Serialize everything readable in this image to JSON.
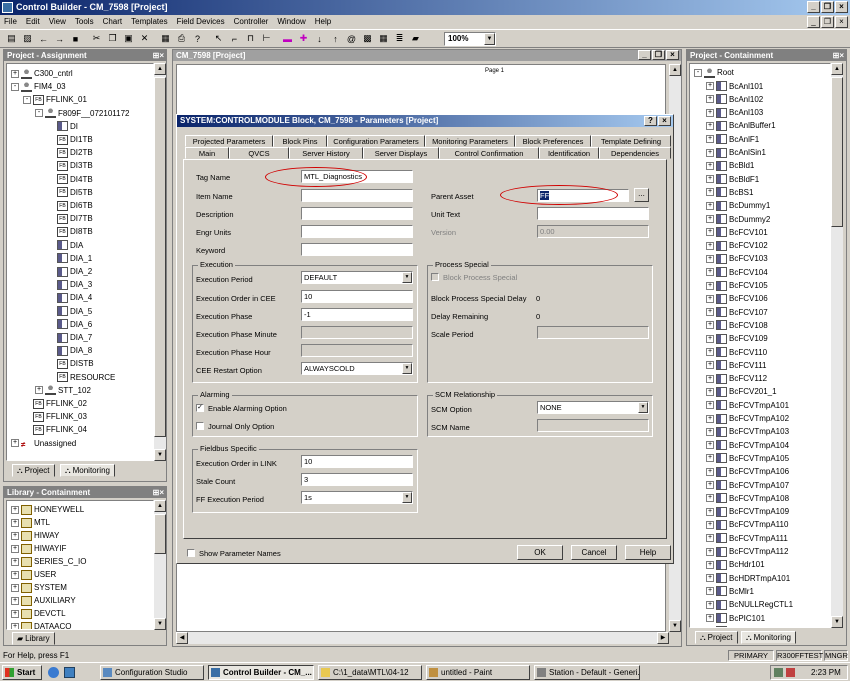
{
  "app": {
    "title": "Control Builder - CM_7598 [Project]"
  },
  "menu": [
    "File",
    "Edit",
    "View",
    "Tools",
    "Chart",
    "Templates",
    "Field Devices",
    "Controller",
    "Window",
    "Help"
  ],
  "toolbar": {
    "zoom": "100%"
  },
  "assignment": {
    "title": "Project - Assignment",
    "items": [
      {
        "label": "C300_cntrl",
        "depth": 1,
        "pm": "+",
        "icon": "node"
      },
      {
        "label": "FIM4_03",
        "depth": 1,
        "pm": "-",
        "icon": "node"
      },
      {
        "label": "FFLINK_01",
        "depth": 2,
        "pm": "-",
        "icon": "fb"
      },
      {
        "label": "F809F__072101172",
        "depth": 3,
        "pm": "-",
        "icon": "node"
      },
      {
        "label": "DI",
        "depth": 4,
        "pm": "",
        "icon": "blk"
      },
      {
        "label": "DI1TB",
        "depth": 4,
        "pm": "",
        "icon": "fb"
      },
      {
        "label": "DI2TB",
        "depth": 4,
        "pm": "",
        "icon": "fb"
      },
      {
        "label": "DI3TB",
        "depth": 4,
        "pm": "",
        "icon": "fb"
      },
      {
        "label": "DI4TB",
        "depth": 4,
        "pm": "",
        "icon": "fb"
      },
      {
        "label": "DI5TB",
        "depth": 4,
        "pm": "",
        "icon": "fb"
      },
      {
        "label": "DI6TB",
        "depth": 4,
        "pm": "",
        "icon": "fb"
      },
      {
        "label": "DI7TB",
        "depth": 4,
        "pm": "",
        "icon": "fb"
      },
      {
        "label": "DI8TB",
        "depth": 4,
        "pm": "",
        "icon": "fb"
      },
      {
        "label": "DIA",
        "depth": 4,
        "pm": "",
        "icon": "blk"
      },
      {
        "label": "DIA_1",
        "depth": 4,
        "pm": "",
        "icon": "blk"
      },
      {
        "label": "DIA_2",
        "depth": 4,
        "pm": "",
        "icon": "blk"
      },
      {
        "label": "DIA_3",
        "depth": 4,
        "pm": "",
        "icon": "blk"
      },
      {
        "label": "DIA_4",
        "depth": 4,
        "pm": "",
        "icon": "blk"
      },
      {
        "label": "DIA_5",
        "depth": 4,
        "pm": "",
        "icon": "blk"
      },
      {
        "label": "DIA_6",
        "depth": 4,
        "pm": "",
        "icon": "blk"
      },
      {
        "label": "DIA_7",
        "depth": 4,
        "pm": "",
        "icon": "blk"
      },
      {
        "label": "DIA_8",
        "depth": 4,
        "pm": "",
        "icon": "blk"
      },
      {
        "label": "DISTB",
        "depth": 4,
        "pm": "",
        "icon": "fb"
      },
      {
        "label": "RESOURCE",
        "depth": 4,
        "pm": "",
        "icon": "fb"
      },
      {
        "label": "STT_102",
        "depth": 3,
        "pm": "+",
        "icon": "node"
      },
      {
        "label": "FFLINK_02",
        "depth": 2,
        "pm": "",
        "icon": "fb"
      },
      {
        "label": "FFLINK_03",
        "depth": 2,
        "pm": "",
        "icon": "fb"
      },
      {
        "label": "FFLINK_04",
        "depth": 2,
        "pm": "",
        "icon": "fb"
      },
      {
        "label": "Unassigned",
        "depth": 1,
        "pm": "+",
        "icon": "ne"
      }
    ],
    "tabs": [
      "Project",
      "Monitoring"
    ]
  },
  "library": {
    "title": "Library - Containment",
    "items": [
      "HONEYWELL",
      "MTL",
      "HIWAY",
      "HIWAYIF",
      "SERIES_C_IO",
      "USER",
      "SYSTEM",
      "AUXILIARY",
      "DEVCTL",
      "DATAACQ"
    ],
    "tab": "Library"
  },
  "chart": {
    "title": "CM_7598 [Project]",
    "page": "Page 1"
  },
  "containment": {
    "title": "Project - Containment",
    "root": "Root",
    "items": [
      "BcAnl101",
      "BcAnl102",
      "BcAnl103",
      "BcAnlBuffer1",
      "BcAnlF1",
      "BcAnlSin1",
      "BcBld1",
      "BcBldF1",
      "BcBS1",
      "BcDummy1",
      "BcDummy2",
      "BcFCV101",
      "BcFCV102",
      "BcFCV103",
      "BcFCV104",
      "BcFCV105",
      "BcFCV106",
      "BcFCV107",
      "BcFCV108",
      "BcFCV109",
      "BcFCV110",
      "BcFCV111",
      "BcFCV112",
      "BcFCV201_1",
      "BcFCVTmpA101",
      "BcFCVTmpA102",
      "BcFCVTmpA103",
      "BcFCVTmpA104",
      "BcFCVTmpA105",
      "BcFCVTmpA106",
      "BcFCVTmpA107",
      "BcFCVTmpA108",
      "BcFCVTmpA109",
      "BcFCVTmpA110",
      "BcFCVTmpA111",
      "BcFCVTmpA112",
      "BcHdr101",
      "BcHDRTmpA101",
      "BcMlr1",
      "BcNULLRegCTL1",
      "BcPIC101",
      "BcPrcp101"
    ],
    "tabs": [
      "Project",
      "Monitoring"
    ]
  },
  "dialog": {
    "title": "SYSTEM:CONTROLMODULE Block, CM_7598 - Parameters [Project]",
    "tabs_back": [
      "Projected Parameters",
      "Block Pins",
      "Configuration Parameters",
      "Monitoring Parameters",
      "Block Preferences",
      "Template Defining"
    ],
    "tabs_front": [
      "Main",
      "QVCS",
      "Server History",
      "Server Displays",
      "Control Confirmation",
      "Identification",
      "Dependencies"
    ],
    "labels": {
      "tag_name": "Tag Name",
      "item_name": "Item Name",
      "description": "Description",
      "engr_units": "Engr Units",
      "keyword": "Keyword",
      "parent_asset": "Parent Asset",
      "unit_text": "Unit Text",
      "version": "Version"
    },
    "values": {
      "tag_name": "MTL_Diagnostics",
      "parent_asset": "FF",
      "version": "0.00"
    },
    "execution": {
      "title": "Execution",
      "period_label": "Execution Period",
      "period": "DEFAULT",
      "order_label": "Execution Order in CEE",
      "order": "10",
      "phase_label": "Execution Phase",
      "phase": "-1",
      "phase_min_label": "Execution Phase Minute",
      "phase_hr_label": "Execution Phase Hour",
      "restart_label": "CEE Restart Option",
      "restart": "ALWAYSCOLD"
    },
    "process_special": {
      "title": "Process Special",
      "block_label": "Block Process Special",
      "delay_label": "Block Process Special Delay",
      "delay": "0",
      "remaining_label": "Delay Remaining",
      "remaining": "0",
      "scale_label": "Scale Period"
    },
    "alarming": {
      "title": "Alarming",
      "enable_label": "Enable Alarming Option",
      "journal_label": "Journal Only Option"
    },
    "scm": {
      "title": "SCM Relationship",
      "option_label": "SCM Option",
      "option": "NONE",
      "name_label": "SCM Name"
    },
    "fieldbus": {
      "title": "Fieldbus Specific",
      "order_label": "Execution Order in LINK",
      "order": "10",
      "stale_label": "Stale Count",
      "stale": "3",
      "ff_period_label": "FF Execution Period",
      "ff_period": "1s"
    },
    "show_names": "Show Parameter Names",
    "ok": "OK",
    "cancel": "Cancel",
    "help": "Help"
  },
  "status": {
    "help": "For Help, press F1",
    "cells": [
      "PRIMARY",
      "R300FFTEST",
      "MNGR"
    ]
  },
  "taskbar": {
    "start": "Start",
    "tasks": [
      "Configuration Studio",
      "Control Builder - CM_...",
      "C:\\1_data\\MTL\\04-12",
      "untitled - Paint",
      "Station - Default - Generi..."
    ],
    "clock": "2:23 PM"
  }
}
